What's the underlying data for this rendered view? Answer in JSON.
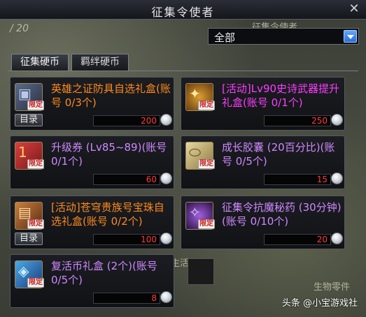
{
  "window": {
    "title": "征集令使者",
    "close_glyph": "✕"
  },
  "level_hint": "/ 20",
  "filter": {
    "selected": "全部"
  },
  "tabs": [
    {
      "label": "征集硬币",
      "active": true
    },
    {
      "label": "羁绊硬币",
      "active": false
    }
  ],
  "limit_badge": "限定",
  "catalog_label": "目录",
  "items": [
    {
      "name": "英雄之证防具自选礼盒(账号 0/3个)",
      "price": "200",
      "color": "orange",
      "icon": "armor-box-icon",
      "has_catalog": true
    },
    {
      "name": "[活动]Lv90史诗武器提升礼盒(账号 0/1个)",
      "price": "250",
      "color": "magenta",
      "icon": "weapon-box-icon",
      "has_catalog": false
    },
    {
      "name": "升级券 (Lv85~89)(账号 0/1个)",
      "price": "60",
      "color": "purple",
      "icon": "level-ticket-icon",
      "has_catalog": false
    },
    {
      "name": "成长胶囊 (20百分比)(账号 0/5个)",
      "price": "15",
      "color": "purple",
      "icon": "growth-capsule-icon",
      "has_catalog": false
    },
    {
      "name": "[活动]苍穹贵族号宝珠自选礼盒(账号 0/2个)",
      "price": "100",
      "color": "orange",
      "icon": "orb-box-icon",
      "has_catalog": true
    },
    {
      "name": "征集令抗魔秘药 (30分钟)(账号 0/10个)",
      "price": "20",
      "color": "purple",
      "icon": "potion-icon",
      "has_catalog": false
    },
    {
      "name": "复活币礼盒 (2个)(账号 0/5个)",
      "price": "8",
      "color": "purple",
      "icon": "revive-coin-box-icon",
      "has_catalog": false
    }
  ],
  "watermark": "头条 @小宝游戏社"
}
